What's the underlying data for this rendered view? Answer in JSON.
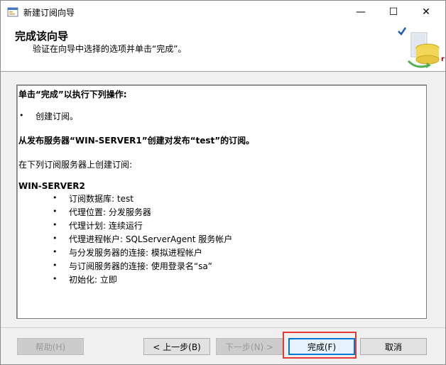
{
  "window": {
    "title": "新建订阅向导",
    "minimize_glyph": "—",
    "maximize_glyph": "☐",
    "close_glyph": "✕"
  },
  "header": {
    "title": "完成该向导",
    "subtitle": "验证在向导中选择的选项并单击“完成”。",
    "side_mark": "r"
  },
  "summary": {
    "heading": "单击“完成”以执行下列操作:",
    "action_bullet": "•",
    "action": "创建订阅。",
    "publication_line": "从发布服务器“WIN-SERVER1”创建对发布“test”的订阅。",
    "subscriber_intro": "在下列订阅服务器上创建订阅:",
    "subscriber_name": "WIN-SERVER2",
    "details": [
      {
        "bullet": "•",
        "text": "订阅数据库: test"
      },
      {
        "bullet": "•",
        "text": "代理位置: 分发服务器"
      },
      {
        "bullet": "•",
        "text": "代理计划: 连续运行"
      },
      {
        "bullet": "•",
        "text": "代理进程帐户: SQLServerAgent 服务帐户"
      },
      {
        "bullet": "•",
        "text": "与分发服务器的连接: 模拟进程帐户"
      },
      {
        "bullet": "•",
        "text": "与订阅服务器的连接: 使用登录名“sa”"
      },
      {
        "bullet": "•",
        "text": "初始化: 立即"
      }
    ]
  },
  "buttons": {
    "help": "帮助(H)",
    "back": "< 上一步(B)",
    "next": "下一步(N) >",
    "finish": "完成(F)",
    "cancel": "取消"
  },
  "colors": {
    "accent": "#0078d7",
    "highlight": "#e53935"
  }
}
